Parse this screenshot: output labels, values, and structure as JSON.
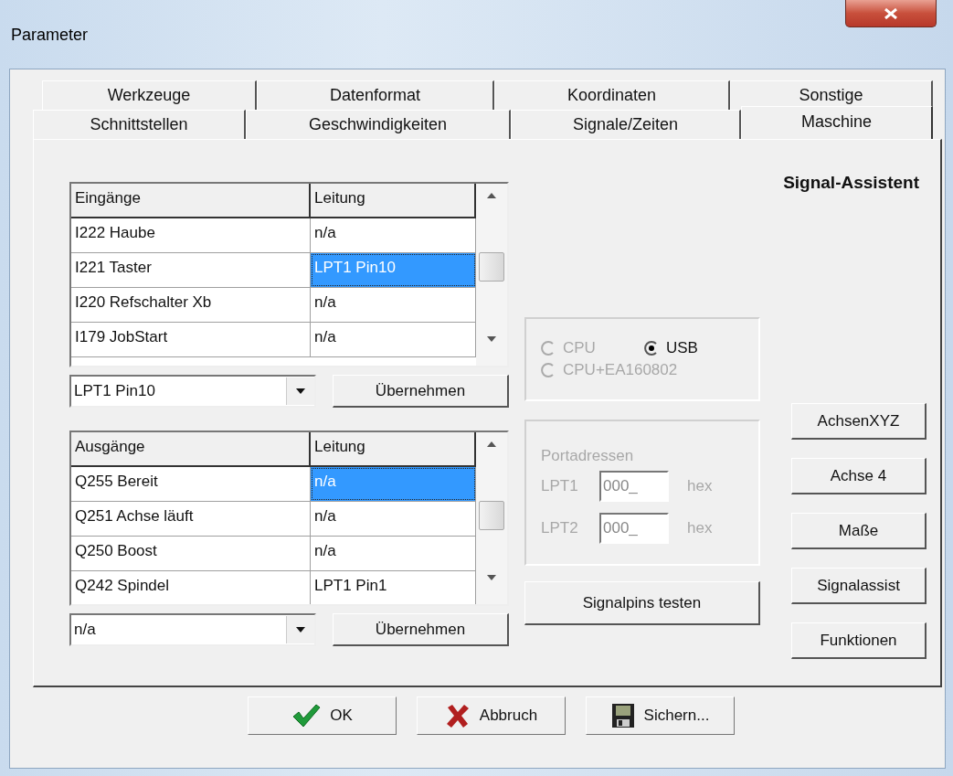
{
  "window": {
    "title": "Parameter"
  },
  "tab_rows": [
    [
      {
        "label": "Werkzeuge",
        "selected": false
      },
      {
        "label": "Datenformat",
        "selected": false
      },
      {
        "label": "Koordinaten",
        "selected": false
      },
      {
        "label": "Sonstige",
        "selected": false
      }
    ],
    [
      {
        "label": "Schnittstellen",
        "selected": false
      },
      {
        "label": "Geschwindigkeiten",
        "selected": false
      },
      {
        "label": "Signale/Zeiten",
        "selected": false
      },
      {
        "label": "Maschine",
        "selected": true
      }
    ]
  ],
  "heading": "Signal-Assistent",
  "tables": [
    {
      "columns": [
        "Eingänge",
        "Leitung"
      ],
      "rows": [
        {
          "name": "I222 Haube",
          "line": "n/a",
          "selected": false
        },
        {
          "name": "I221 Taster",
          "line": "LPT1 Pin10",
          "selected": true
        },
        {
          "name": "I220 Refschalter Xb",
          "line": "n/a",
          "selected": false
        },
        {
          "name": "I179 JobStart",
          "line": "n/a",
          "selected": false
        }
      ],
      "combo": "LPT1 Pin10",
      "apply": "Übernehmen"
    },
    {
      "columns": [
        "Ausgänge",
        "Leitung"
      ],
      "rows": [
        {
          "name": "Q255 Bereit",
          "line": "n/a",
          "selected": true
        },
        {
          "name": "Q251 Achse läuft",
          "line": "n/a",
          "selected": false
        },
        {
          "name": "Q250 Boost",
          "line": "n/a",
          "selected": false
        },
        {
          "name": "Q242 Spindel",
          "line": "LPT1 Pin1",
          "selected": false
        }
      ],
      "combo": "n/a",
      "apply": "Übernehmen"
    }
  ],
  "cpu_options": [
    {
      "label": "CPU",
      "selected": false,
      "disabled": true
    },
    {
      "label": "USB",
      "selected": true,
      "disabled": false
    },
    {
      "label": "CPU+EA160802",
      "selected": false,
      "disabled": true
    }
  ],
  "port_addresses": {
    "title": "Portadressen",
    "ports": [
      {
        "label": "LPT1",
        "value": "000_",
        "unit": "hex"
      },
      {
        "label": "LPT2",
        "value": "000_",
        "unit": "hex"
      }
    ]
  },
  "test_button": "Signalpins testen",
  "side_buttons": [
    "AchsenXYZ",
    "Achse 4",
    "Maße",
    "Signalassist",
    "Funktionen"
  ],
  "footer_buttons": [
    {
      "label": "OK",
      "kind": "confirm"
    },
    {
      "label": "Abbruch",
      "kind": "cancel"
    },
    {
      "label": "Sichern...",
      "kind": "save"
    }
  ]
}
